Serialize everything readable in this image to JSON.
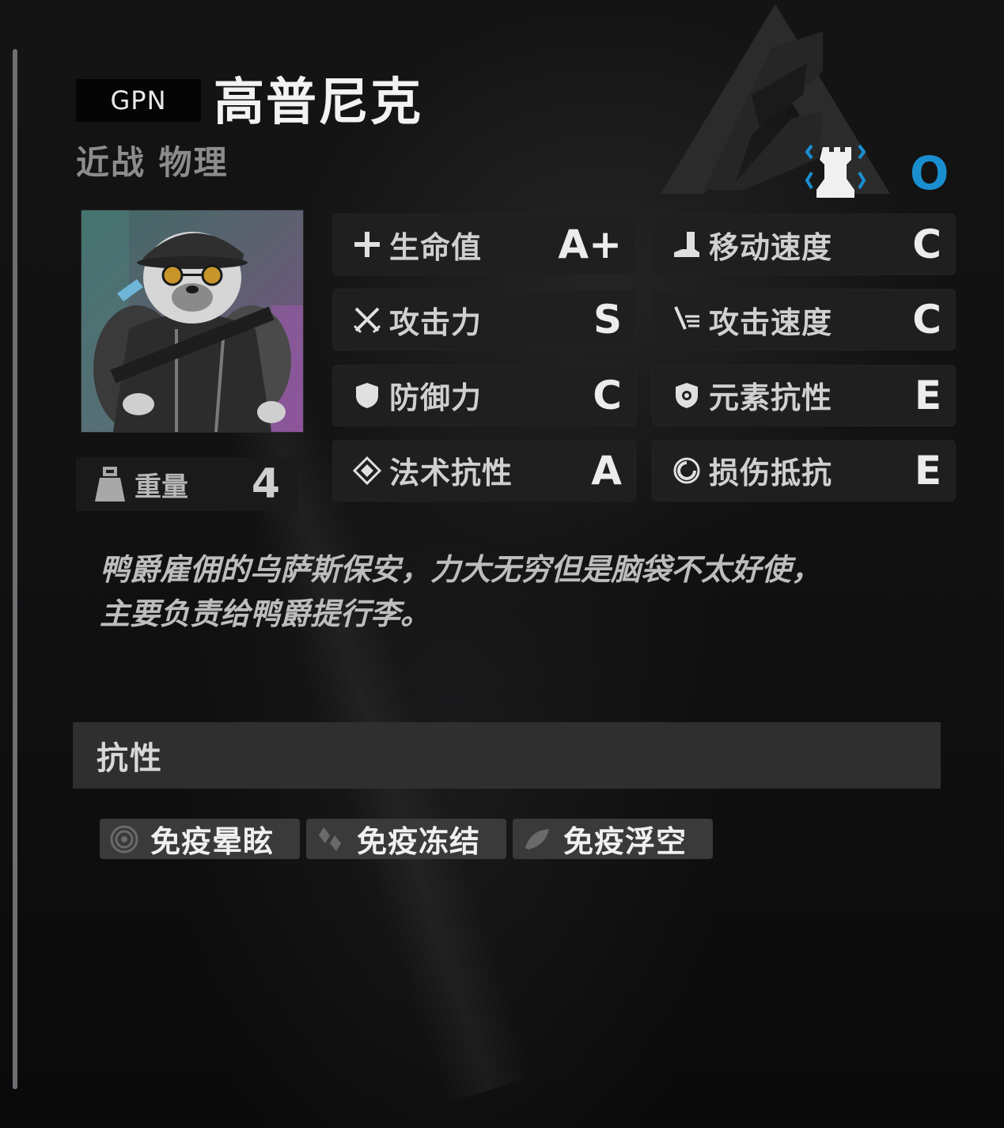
{
  "header": {
    "code": "GPN",
    "name": "高普尼克",
    "type": "近战 物理",
    "level_value": "O",
    "level_icon": "rook-icon",
    "accent_color": "#1a8fd0"
  },
  "portrait": {
    "icon": "seal-bodyguard-portrait"
  },
  "weight": {
    "label": "重量",
    "value": "4",
    "icon": "weight-icon"
  },
  "stats": [
    {
      "label": "生命值",
      "grade": "A+",
      "icon": "plus-icon"
    },
    {
      "label": "移动速度",
      "grade": "C",
      "icon": "boot-icon"
    },
    {
      "label": "攻击力",
      "grade": "S",
      "icon": "crossed-swords-icon"
    },
    {
      "label": "攻击速度",
      "grade": "C",
      "icon": "sword-speed-icon"
    },
    {
      "label": "防御力",
      "grade": "C",
      "icon": "shield-icon"
    },
    {
      "label": "元素抗性",
      "grade": "E",
      "icon": "element-shield-icon"
    },
    {
      "label": "法术抗性",
      "grade": "A",
      "icon": "diamond-icon"
    },
    {
      "label": "损伤抵抗",
      "grade": "E",
      "icon": "ring-icon"
    }
  ],
  "description": {
    "line1": "鸭爵雇佣的乌萨斯保安，力大无穷但是脑袋不太好使，",
    "line2": "主要负责给鸭爵提行李。"
  },
  "resistance_section": {
    "title": "抗性"
  },
  "immunities": [
    {
      "label": "免疫晕眩",
      "icon": "spiral-icon"
    },
    {
      "label": "免疫冻结",
      "icon": "ice-icon"
    },
    {
      "label": "免疫浮空",
      "icon": "feather-icon"
    }
  ]
}
